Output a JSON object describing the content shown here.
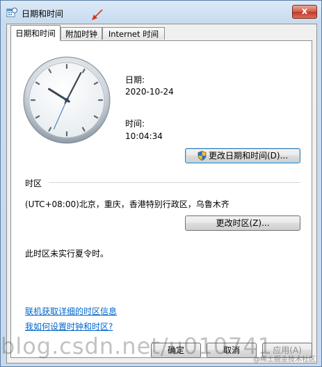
{
  "window": {
    "title": "日期和时间",
    "close_label": "x"
  },
  "tabs": [
    {
      "label": "日期和时间",
      "active": true
    },
    {
      "label": "附加时钟",
      "active": false
    },
    {
      "label": "Internet 时间",
      "active": false
    }
  ],
  "datetime": {
    "date_label": "日期:",
    "date_value": "2020-10-24",
    "time_label": "时间:",
    "time_value": "10:04:34",
    "change_button": "更改日期和时间(D)..."
  },
  "timezone": {
    "section_label": "时区",
    "value": "(UTC+08:00)北京，重庆，香港特别行政区，乌鲁木齐",
    "change_button": "更改时区(Z)...",
    "dst_note": "此时区未实行夏令时。"
  },
  "links": {
    "online_info": "联机获取详细的时区信息",
    "how_to": "我如何设置时钟和时区?"
  },
  "footer": {
    "ok": "确定",
    "cancel": "取消",
    "apply": "应用(A)"
  },
  "watermark": {
    "text": "blog.csdn.net/u010741",
    "juejin": "@稀土掘金技术社区"
  },
  "colors": {
    "link": "#0066cc",
    "accent_arrow": "#e0301e"
  }
}
